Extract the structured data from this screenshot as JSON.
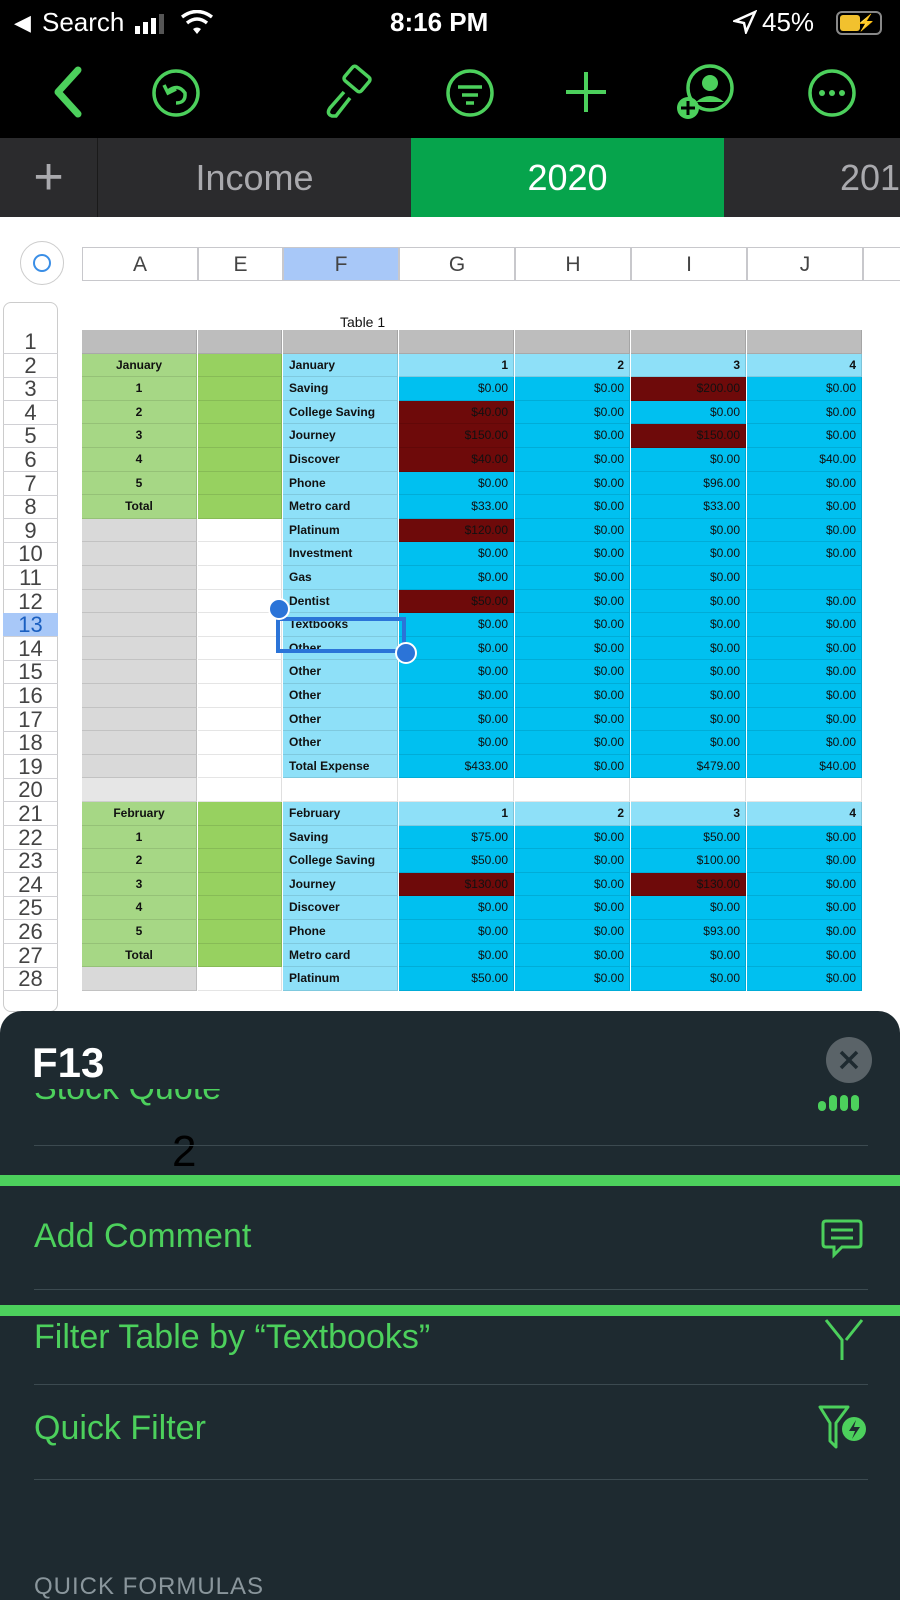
{
  "status": {
    "carrier": "Search",
    "time": "8:16 PM",
    "battery": "45%"
  },
  "toolbar": {
    "icons": [
      "back-icon",
      "undo-icon",
      "format-brush-icon",
      "organize-icon",
      "insert-icon",
      "collaborate-icon",
      "more-icon"
    ]
  },
  "tabs": {
    "add": "+",
    "items": [
      "Income",
      "2020",
      "201"
    ],
    "active": "2020"
  },
  "sheet": {
    "columns": [
      "A",
      "E",
      "F",
      "G",
      "H",
      "I",
      "J"
    ],
    "table_title": "Table 1",
    "rows": [
      "1",
      "2",
      "3",
      "4",
      "5",
      "6",
      "7",
      "8",
      "9",
      "10",
      "11",
      "12",
      "13",
      "14",
      "15",
      "16",
      "17",
      "18",
      "19",
      "20",
      "21",
      "22",
      "23",
      "24",
      "25",
      "26",
      "27",
      "28"
    ],
    "data": [
      [
        "",
        "",
        "",
        "",
        "",
        "",
        ""
      ],
      [
        "January",
        "",
        "January",
        "1",
        "2",
        "3",
        "4"
      ],
      [
        "1",
        "",
        "Saving",
        "$0.00",
        "$0.00",
        "$200.00",
        "$0.00"
      ],
      [
        "2",
        "",
        "College Saving",
        "$40.00",
        "$0.00",
        "$0.00",
        "$0.00"
      ],
      [
        "3",
        "",
        "Journey",
        "$150.00",
        "$0.00",
        "$150.00",
        "$0.00"
      ],
      [
        "4",
        "",
        "Discover",
        "$40.00",
        "$0.00",
        "$0.00",
        "$40.00"
      ],
      [
        "5",
        "",
        "Phone",
        "$0.00",
        "$0.00",
        "$96.00",
        "$0.00"
      ],
      [
        "Total",
        "",
        "Metro card",
        "$33.00",
        "$0.00",
        "$33.00",
        "$0.00"
      ],
      [
        "",
        "",
        "Platinum",
        "$120.00",
        "$0.00",
        "$0.00",
        "$0.00"
      ],
      [
        "",
        "",
        "Investment",
        "$0.00",
        "$0.00",
        "$0.00",
        "$0.00"
      ],
      [
        "",
        "",
        "Gas",
        "$0.00",
        "$0.00",
        "$0.00",
        ""
      ],
      [
        "",
        "",
        "Dentist",
        "$50.00",
        "$0.00",
        "$0.00",
        "$0.00"
      ],
      [
        "",
        "",
        "Textbooks",
        "$0.00",
        "$0.00",
        "$0.00",
        "$0.00"
      ],
      [
        "",
        "",
        "Other",
        "$0.00",
        "$0.00",
        "$0.00",
        "$0.00"
      ],
      [
        "",
        "",
        "Other",
        "$0.00",
        "$0.00",
        "$0.00",
        "$0.00"
      ],
      [
        "",
        "",
        "Other",
        "$0.00",
        "$0.00",
        "$0.00",
        "$0.00"
      ],
      [
        "",
        "",
        "Other",
        "$0.00",
        "$0.00",
        "$0.00",
        "$0.00"
      ],
      [
        "",
        "",
        "Other",
        "$0.00",
        "$0.00",
        "$0.00",
        "$0.00"
      ],
      [
        "",
        "",
        "Total Expense",
        "$433.00",
        "$0.00",
        "$479.00",
        "$40.00"
      ],
      [
        "",
        "",
        "",
        "",
        "",
        "",
        ""
      ],
      [
        "February",
        "",
        "February",
        "1",
        "2",
        "3",
        "4"
      ],
      [
        "1",
        "",
        "Saving",
        "$75.00",
        "$0.00",
        "$50.00",
        "$0.00"
      ],
      [
        "2",
        "",
        "College Saving",
        "$50.00",
        "$0.00",
        "$100.00",
        "$0.00"
      ],
      [
        "3",
        "",
        "Journey",
        "$130.00",
        "$0.00",
        "$130.00",
        "$0.00"
      ],
      [
        "4",
        "",
        "Discover",
        "$0.00",
        "$0.00",
        "$0.00",
        "$0.00"
      ],
      [
        "5",
        "",
        "Phone",
        "$0.00",
        "$0.00",
        "$93.00",
        "$0.00"
      ],
      [
        "Total",
        "",
        "Metro card",
        "$0.00",
        "$0.00",
        "$0.00",
        "$0.00"
      ],
      [
        "",
        "",
        "Platinum",
        "$50.00",
        "$0.00",
        "$0.00",
        "$0.00"
      ]
    ],
    "highlighted_cells": [
      [
        2,
        5
      ],
      [
        3,
        3
      ],
      [
        4,
        3
      ],
      [
        4,
        5
      ],
      [
        5,
        3
      ],
      [
        8,
        3
      ],
      [
        11,
        3
      ],
      [
        23,
        3
      ],
      [
        23,
        5
      ]
    ],
    "selected_cell": "F13",
    "selected_row": "13",
    "selected_column": "F",
    "colors": {
      "header_blue": "#a8c8f8",
      "cell_cyan": "#00c0f0",
      "label_cyan": "#8ee0f8",
      "green": "#a6d785",
      "dark_red": "#6e0a0a"
    }
  },
  "panel": {
    "title": "F13",
    "partial_item": "Stock Quote",
    "stray_text": "2",
    "items": [
      {
        "label": "Add Comment",
        "icon": "comment-icon"
      },
      {
        "label": "Filter Table by “Textbooks”",
        "icon": "filter-icon"
      },
      {
        "label": "Quick Filter",
        "icon": "quick-filter-icon"
      }
    ],
    "section": "QUICK FORMULAS",
    "accent": "#4cd05c"
  }
}
